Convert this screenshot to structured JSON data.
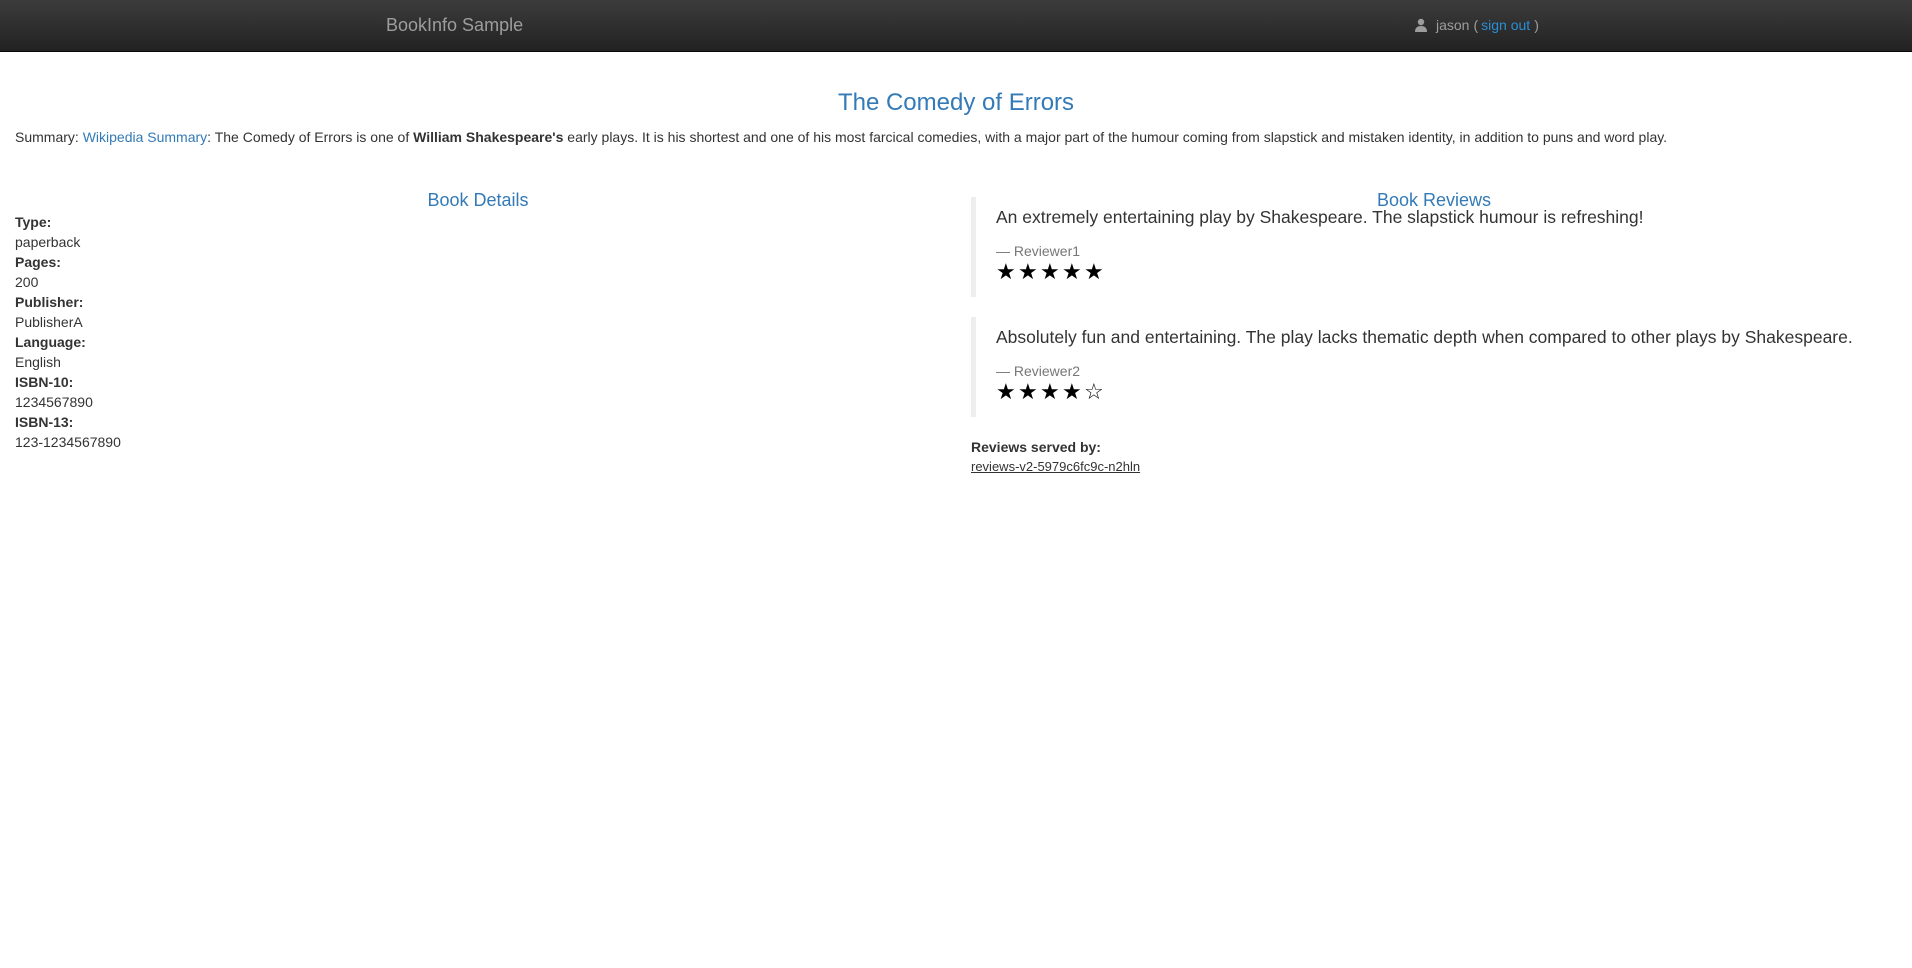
{
  "navbar": {
    "brand": "BookInfo Sample",
    "user": {
      "icon": "user-icon",
      "name": "jason",
      "open_paren": "(",
      "signout_label": "sign out",
      "close_paren": ")"
    }
  },
  "book": {
    "title": "The Comedy of Errors",
    "summary": {
      "label": "Summary:",
      "link_label": "Wikipedia Summary",
      "text_before_bold": ": The Comedy of Errors is one of",
      "bold": "William Shakespeare's",
      "text_after_bold": "early plays. It is his shortest and one of his most farcical comedies, with a major part of the humour coming from slapstick and mistaken identity, in addition to puns and word play."
    }
  },
  "details": {
    "heading": "Book Details",
    "fields": [
      {
        "label": "Type:",
        "value": "paperback"
      },
      {
        "label": "Pages:",
        "value": "200"
      },
      {
        "label": "Publisher:",
        "value": "PublisherA"
      },
      {
        "label": "Language:",
        "value": "English"
      },
      {
        "label": "ISBN-10:",
        "value": "1234567890"
      },
      {
        "label": "ISBN-13:",
        "value": "123-1234567890"
      }
    ]
  },
  "reviews": {
    "heading": "Book Reviews",
    "items": [
      {
        "text": "An extremely entertaining play by Shakespeare. The slapstick humour is refreshing!",
        "reviewer": "— Reviewer1",
        "rating": 5,
        "max_rating": 5
      },
      {
        "text": "Absolutely fun and entertaining. The play lacks thematic depth when compared to other plays by Shakespeare.",
        "reviewer": "— Reviewer2",
        "rating": 4,
        "max_rating": 5
      }
    ],
    "served_by_label": "Reviews served by:",
    "served_by_host": "reviews-v2-5979c6fc9c-n2hln"
  },
  "colors": {
    "navbar_top": "#3c3c3c",
    "navbar_bottom": "#222222",
    "brand": "#9d9d9d",
    "link": "#337ab7",
    "signout_link": "#2a8fd6",
    "star": "#000000",
    "blockquote_border": "#eeeeee"
  }
}
